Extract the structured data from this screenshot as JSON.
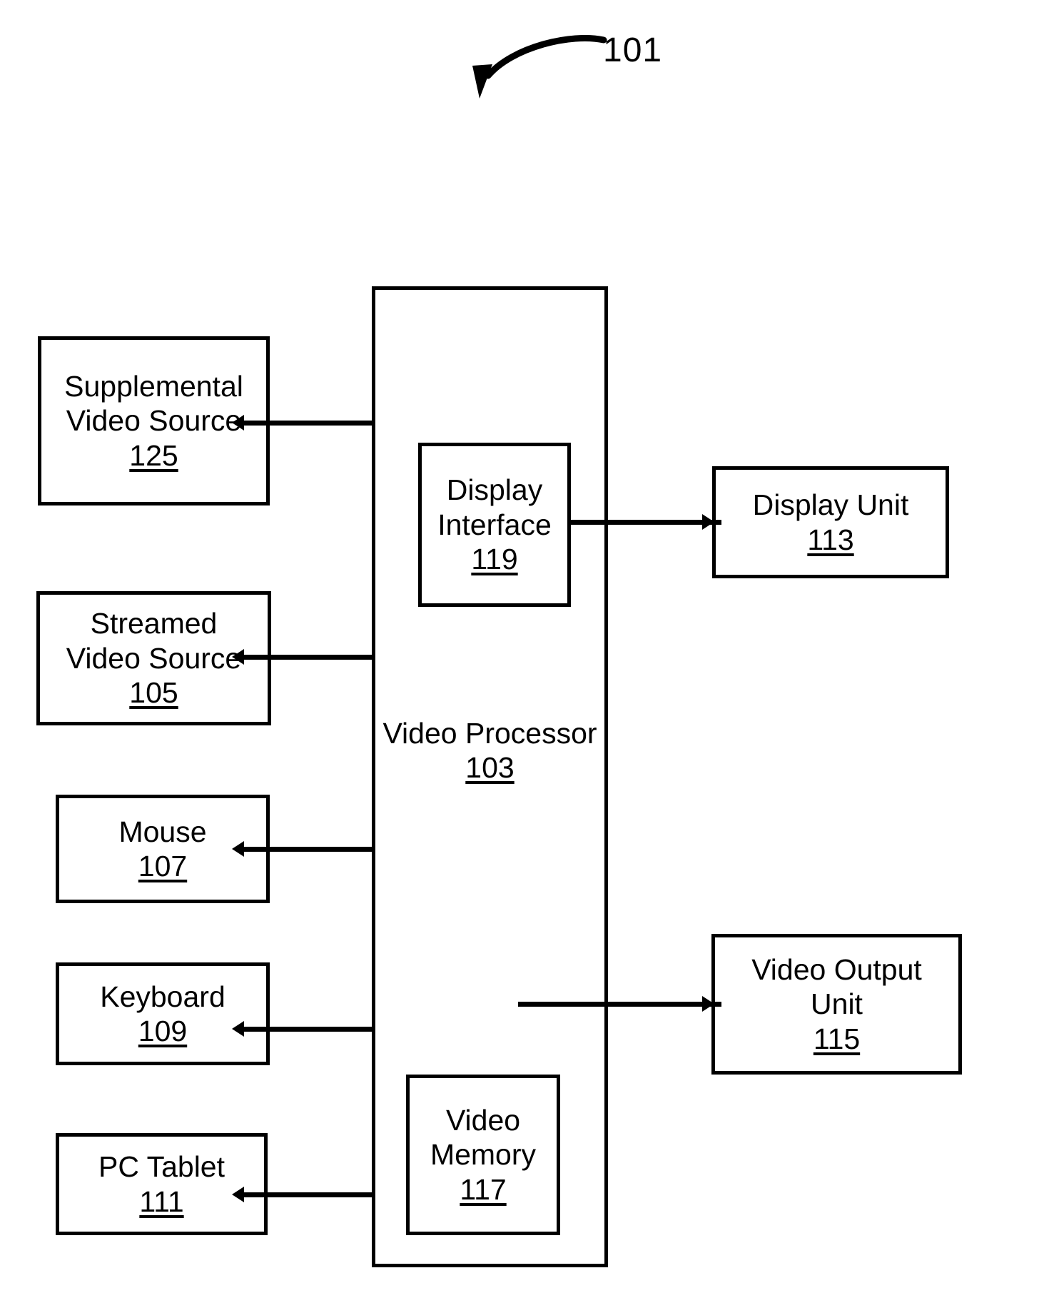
{
  "figure": {
    "number": "101",
    "callout_icon": "curved-arrow-icon"
  },
  "diagram": {
    "type": "block-diagram",
    "title": "Video processing system block diagram",
    "main_block": {
      "name": "video-processor",
      "label_line1": "Video",
      "label_line2": "Processor",
      "ref": "103"
    },
    "inner_blocks": [
      {
        "name": "display-interface",
        "label_line1": "Display",
        "label_line2": "Interface",
        "ref": "119"
      },
      {
        "name": "video-memory",
        "label_line1": "Video",
        "label_line2": "Memory",
        "ref": "117"
      }
    ],
    "left_blocks": [
      {
        "name": "supplemental-video-source",
        "label_line1": "Supplemental",
        "label_line2": "Video Source",
        "ref": "125"
      },
      {
        "name": "streamed-video-source",
        "label_line1": "Streamed",
        "label_line2": "Video Source",
        "ref": "105"
      },
      {
        "name": "mouse",
        "label_line1": "Mouse",
        "label_line2": "",
        "ref": "107"
      },
      {
        "name": "keyboard",
        "label_line1": "Keyboard",
        "label_line2": "",
        "ref": "109"
      },
      {
        "name": "pc-tablet",
        "label_line1": "PC Tablet",
        "label_line2": "",
        "ref": "111"
      }
    ],
    "right_blocks": [
      {
        "name": "display-unit",
        "label_line1": "Display Unit",
        "label_line2": "",
        "ref": "113"
      },
      {
        "name": "video-output-unit",
        "label_line1": "Video Output",
        "label_line2": "Unit",
        "ref": "115"
      }
    ],
    "connections": [
      {
        "from": "supplemental-video-source",
        "to": "video-processor",
        "arrow": "left"
      },
      {
        "from": "streamed-video-source",
        "to": "video-processor",
        "arrow": "left"
      },
      {
        "from": "mouse",
        "to": "video-processor",
        "arrow": "left"
      },
      {
        "from": "keyboard",
        "to": "video-processor",
        "arrow": "left"
      },
      {
        "from": "pc-tablet",
        "to": "video-processor",
        "arrow": "left"
      },
      {
        "from": "display-interface",
        "to": "display-unit",
        "arrow": "right"
      },
      {
        "from": "video-processor",
        "to": "video-output-unit",
        "arrow": "right"
      }
    ],
    "colors": {
      "stroke": "#000000",
      "background": "#ffffff"
    }
  }
}
